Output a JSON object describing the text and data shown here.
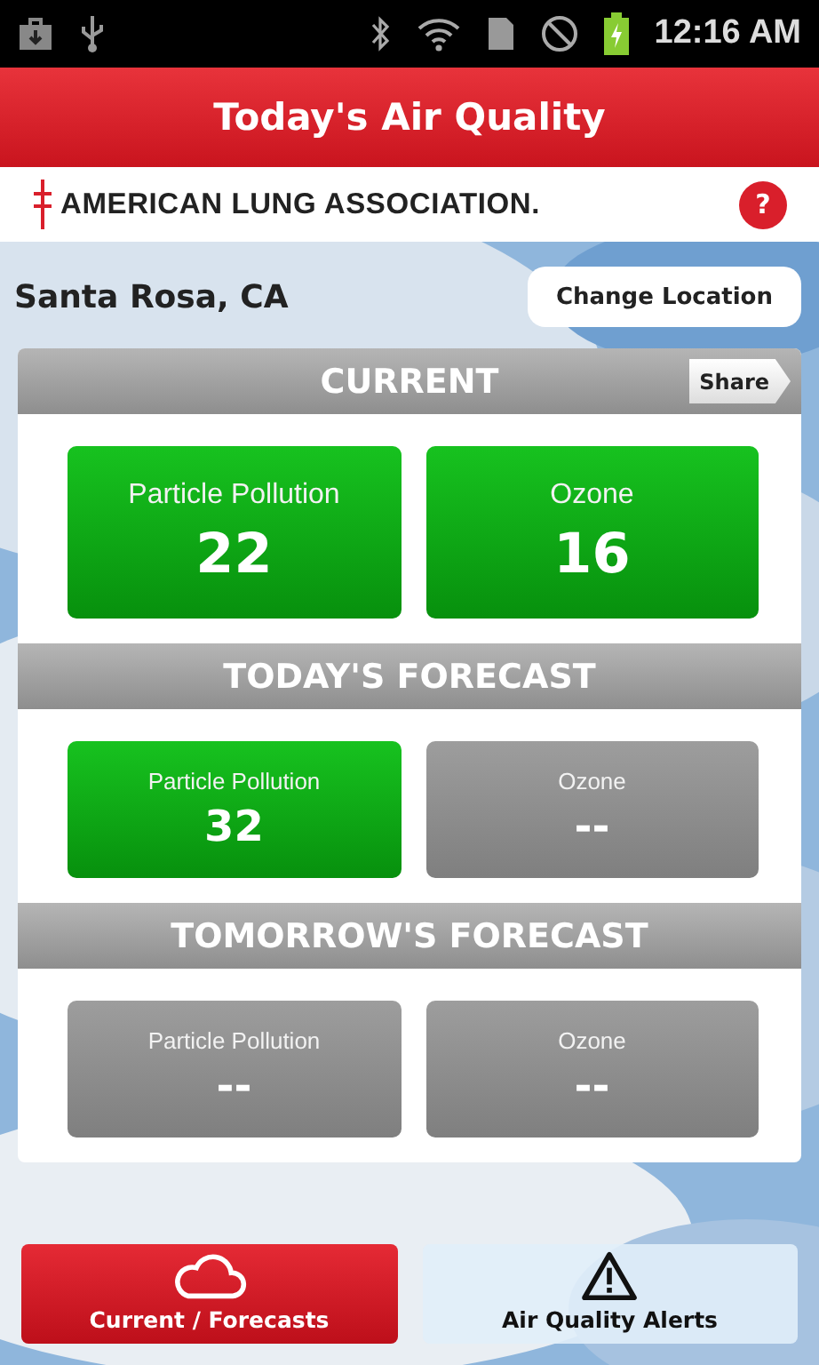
{
  "status_bar": {
    "time": "12:16 AM"
  },
  "title_bar": {
    "title": "Today's Air Quality"
  },
  "brand_bar": {
    "logo_text": "AMERICAN LUNG ASSOCIATION.",
    "help": "?"
  },
  "location": {
    "name": "Santa Rosa, CA",
    "button": "Change Location"
  },
  "sections": [
    {
      "title": "CURRENT",
      "share": "Share",
      "tiles": [
        {
          "label": "Particle Pollution",
          "value": "22",
          "kind": "good"
        },
        {
          "label": "Ozone",
          "value": "16",
          "kind": "good"
        }
      ]
    },
    {
      "title": "TODAY'S FORECAST",
      "tiles": [
        {
          "label": "Particle Pollution",
          "value": "32",
          "kind": "good"
        },
        {
          "label": "Ozone",
          "value": "--",
          "kind": "unavailable"
        }
      ]
    },
    {
      "title": "TOMORROW'S FORECAST",
      "tiles": [
        {
          "label": "Particle Pollution",
          "value": "--",
          "kind": "unavailable"
        },
        {
          "label": "Ozone",
          "value": "--",
          "kind": "unavailable"
        }
      ]
    }
  ],
  "bottom_tabs": [
    {
      "label": "Current / Forecasts",
      "kind": "cloud",
      "selected": true
    },
    {
      "label": "Air Quality Alerts",
      "kind": "warning",
      "selected": false
    }
  ]
}
